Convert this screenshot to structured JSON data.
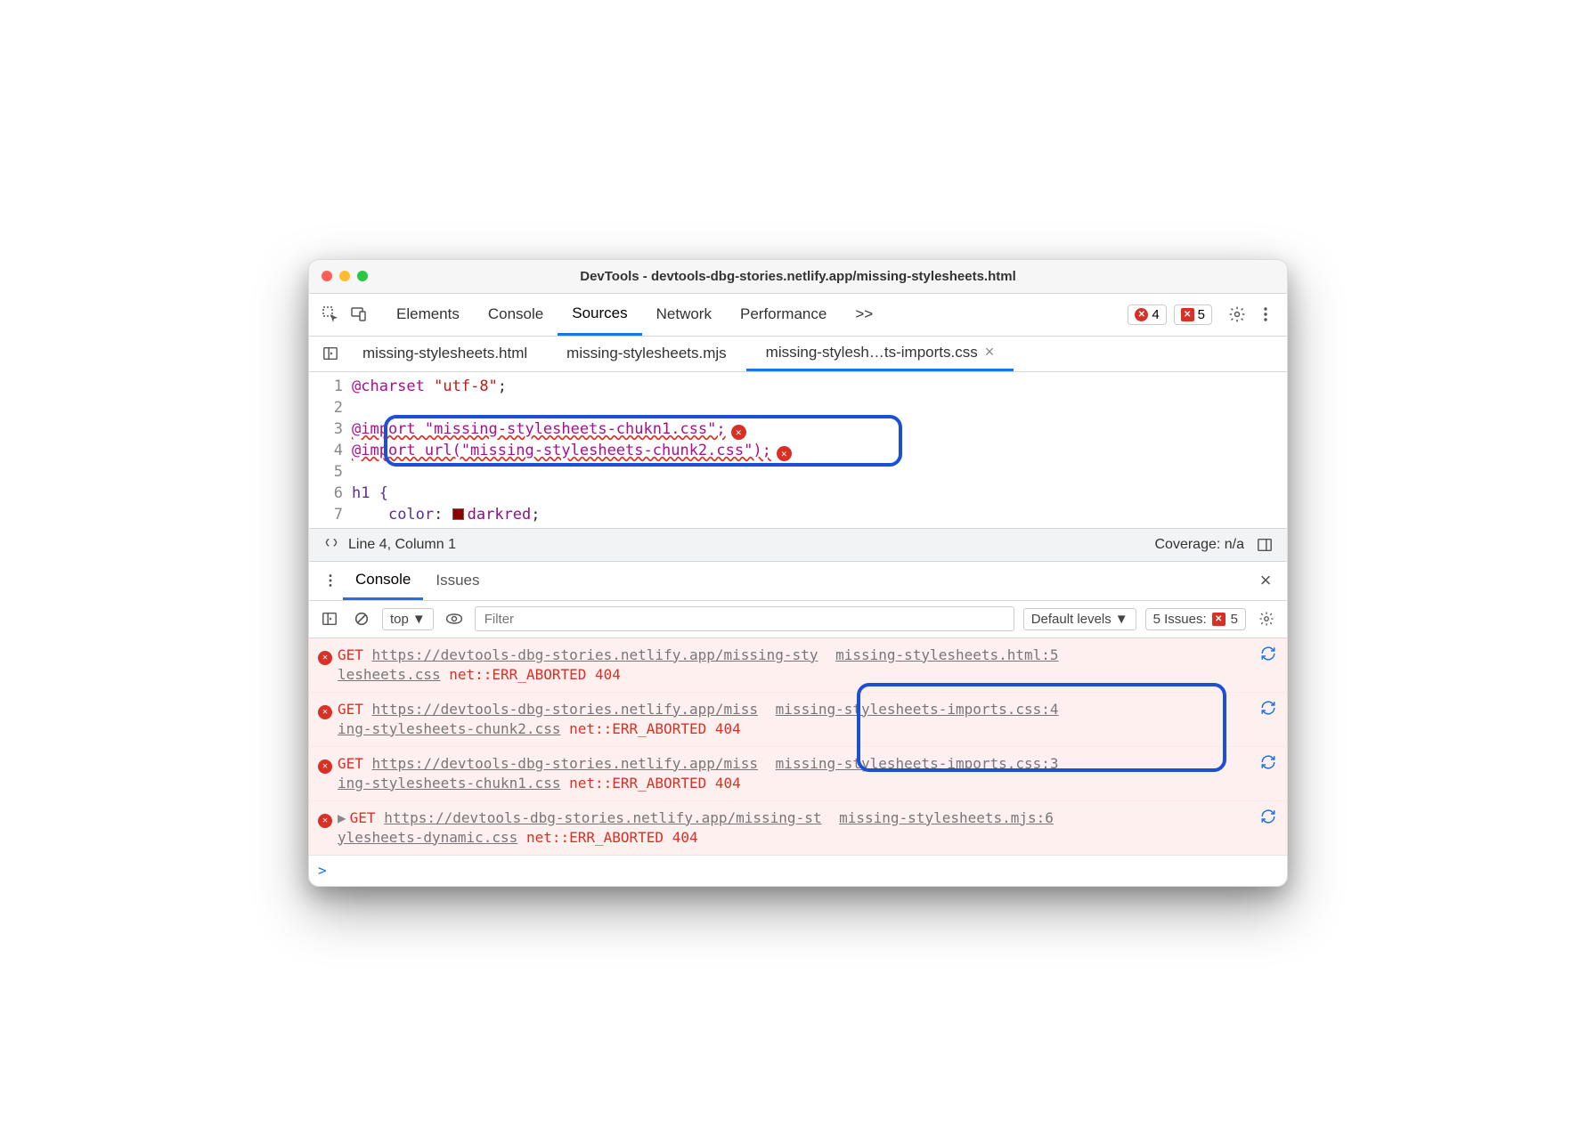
{
  "window": {
    "title": "DevTools - devtools-dbg-stories.netlify.app/missing-stylesheets.html"
  },
  "toolbar": {
    "panels": [
      "Elements",
      "Console",
      "Sources",
      "Network",
      "Performance"
    ],
    "active_panel": "Sources",
    "overflow": ">>",
    "error_count": "4",
    "issue_count": "5"
  },
  "filetabs": {
    "items": [
      {
        "label": "missing-stylesheets.html"
      },
      {
        "label": "missing-stylesheets.mjs"
      },
      {
        "label": "missing-stylesh…ts-imports.css",
        "active": true
      }
    ]
  },
  "source": {
    "lines": [
      {
        "n": "1",
        "segments": [
          {
            "t": "@charset",
            "c": "kw"
          },
          {
            "t": " "
          },
          {
            "t": "\"utf-8\"",
            "c": "str"
          },
          {
            "t": ";"
          }
        ]
      },
      {
        "n": "2",
        "segments": []
      },
      {
        "n": "3",
        "segments": [
          {
            "t": "@import \"missing-stylesheets-chukn1.css\";",
            "c": "kw err"
          }
        ],
        "error": true
      },
      {
        "n": "4",
        "segments": [
          {
            "t": "@import url(\"missing-stylesheets-chunk2.css\");",
            "c": "kw err"
          }
        ],
        "error": true
      },
      {
        "n": "5",
        "segments": []
      },
      {
        "n": "6",
        "segments": [
          {
            "t": "h1 {",
            "c": "prop"
          }
        ]
      },
      {
        "n": "7",
        "segments": [
          {
            "t": "    "
          },
          {
            "t": "color",
            "c": "prop"
          },
          {
            "t": ": "
          },
          {
            "t": "",
            "swatch": true
          },
          {
            "t": "darkred",
            "c": "val"
          },
          {
            "t": ";"
          }
        ]
      }
    ]
  },
  "statusbar": {
    "cursor": "Line 4, Column 1",
    "coverage": "Coverage: n/a"
  },
  "drawer": {
    "tabs": [
      "Console",
      "Issues"
    ],
    "active": "Console"
  },
  "console_toolbar": {
    "context": "top",
    "filter_placeholder": "Filter",
    "levels": "Default levels",
    "issues_label": "5 Issues:",
    "issues_count": "5"
  },
  "console": {
    "messages": [
      {
        "get": "GET",
        "url1": "https://devtools-dbg-stories.netlify.app/missing-sty",
        "url2": "lesheets.css",
        "err": "net::ERR_ABORTED 404",
        "src": "missing-stylesheets.html:5"
      },
      {
        "get": "GET",
        "url1": "https://devtools-dbg-stories.netlify.app/miss",
        "url2": "ing-stylesheets-chunk2.css",
        "err": "net::ERR_ABORTED 404",
        "src": "missing-stylesheets-imports.css:4",
        "hl": true
      },
      {
        "get": "GET",
        "url1": "https://devtools-dbg-stories.netlify.app/miss",
        "url2": "ing-stylesheets-chukn1.css",
        "err": "net::ERR_ABORTED 404",
        "src": "missing-stylesheets-imports.css:3",
        "hl": true
      },
      {
        "get": "GET",
        "url1": "https://devtools-dbg-stories.netlify.app/missing-st",
        "url2": "ylesheets-dynamic.css",
        "err": "net::ERR_ABORTED 404",
        "src": "missing-stylesheets.mjs:6",
        "expand": true
      }
    ],
    "prompt": ">"
  }
}
